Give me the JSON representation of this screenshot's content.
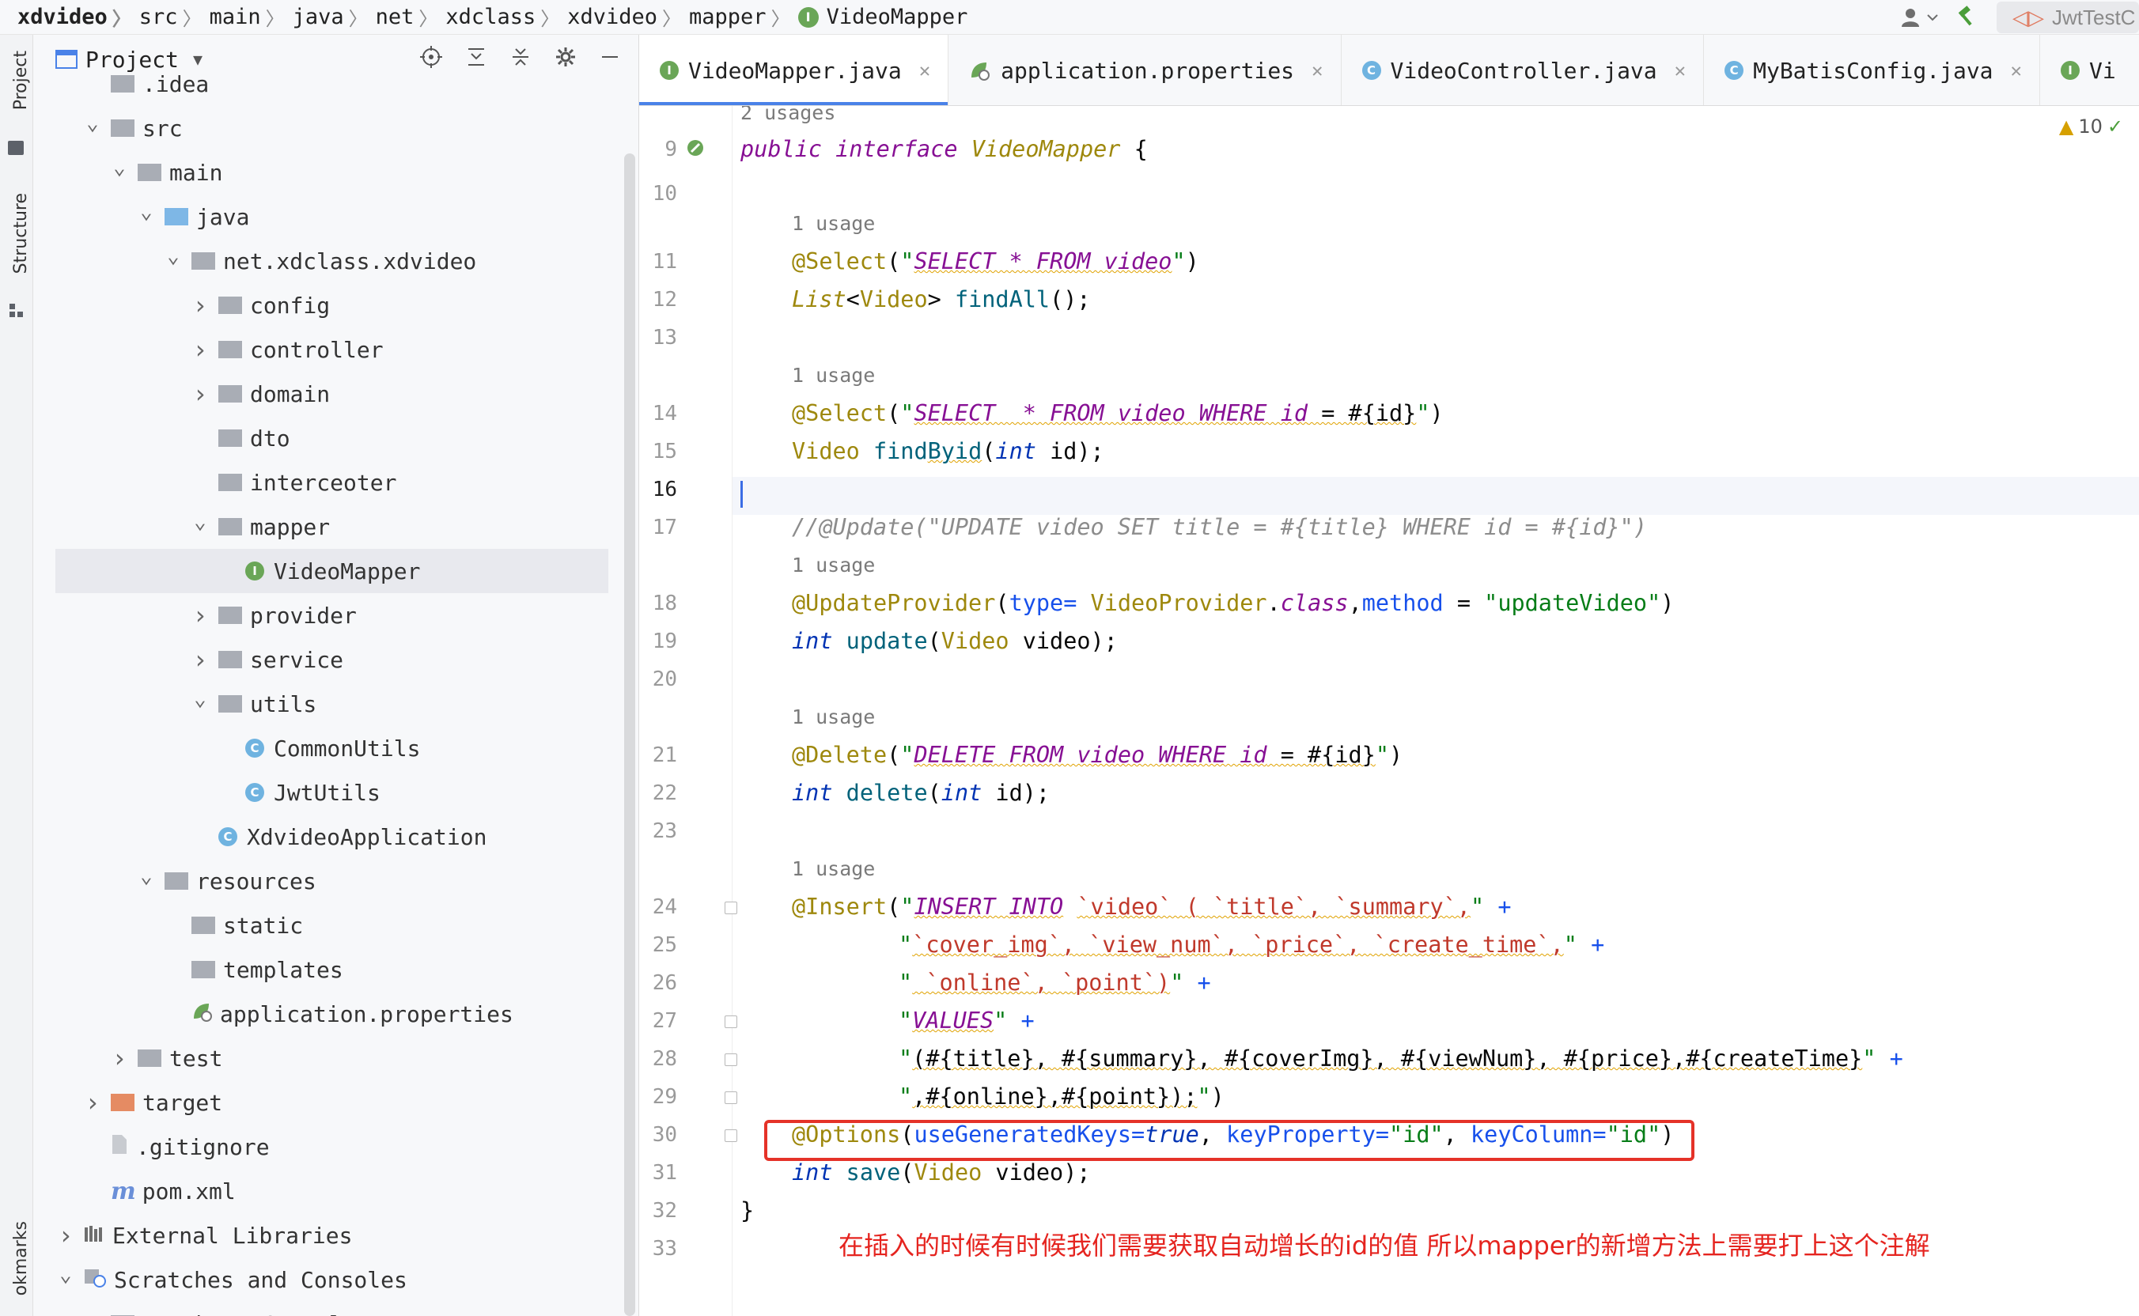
{
  "breadcrumb": [
    "xdvideo",
    "src",
    "main",
    "java",
    "net",
    "xdclass",
    "xdvideo",
    "mapper",
    "VideoMapper"
  ],
  "toolbar": {
    "run_config": "JwtTestC"
  },
  "side_tools": {
    "project": "Project",
    "structure": "Structure",
    "bookmarks": "okmarks"
  },
  "project_panel": {
    "title": "Project",
    "tree": [
      {
        "label": ".idea",
        "indent": 1,
        "kind": "folder-gray",
        "chev": ""
      },
      {
        "label": "src",
        "indent": 1,
        "kind": "folder-gray",
        "chev": "down"
      },
      {
        "label": "main",
        "indent": 2,
        "kind": "folder-gray",
        "chev": "down"
      },
      {
        "label": "java",
        "indent": 3,
        "kind": "folder-blue",
        "chev": "down"
      },
      {
        "label": "net.xdclass.xdvideo",
        "indent": 4,
        "kind": "folder-gray",
        "chev": "down"
      },
      {
        "label": "config",
        "indent": 5,
        "kind": "folder-gray",
        "chev": "right"
      },
      {
        "label": "controller",
        "indent": 5,
        "kind": "folder-gray",
        "chev": "right"
      },
      {
        "label": "domain",
        "indent": 5,
        "kind": "folder-gray",
        "chev": "right"
      },
      {
        "label": "dto",
        "indent": 5,
        "kind": "folder-gray",
        "chev": ""
      },
      {
        "label": "interceoter",
        "indent": 5,
        "kind": "folder-gray",
        "chev": ""
      },
      {
        "label": "mapper",
        "indent": 5,
        "kind": "folder-gray",
        "chev": "down"
      },
      {
        "label": "VideoMapper",
        "indent": 6,
        "kind": "interface",
        "chev": "",
        "selected": true
      },
      {
        "label": "provider",
        "indent": 5,
        "kind": "folder-gray",
        "chev": "right"
      },
      {
        "label": "service",
        "indent": 5,
        "kind": "folder-gray",
        "chev": "right"
      },
      {
        "label": "utils",
        "indent": 5,
        "kind": "folder-gray",
        "chev": "down"
      },
      {
        "label": "CommonUtils",
        "indent": 6,
        "kind": "class",
        "chev": ""
      },
      {
        "label": "JwtUtils",
        "indent": 6,
        "kind": "class",
        "chev": ""
      },
      {
        "label": "XdvideoApplication",
        "indent": 5,
        "kind": "class",
        "chev": ""
      },
      {
        "label": "resources",
        "indent": 3,
        "kind": "folder-gray",
        "chev": "down"
      },
      {
        "label": "static",
        "indent": 4,
        "kind": "folder-gray",
        "chev": ""
      },
      {
        "label": "templates",
        "indent": 4,
        "kind": "folder-gray",
        "chev": ""
      },
      {
        "label": "application.properties",
        "indent": 4,
        "kind": "props",
        "chev": ""
      },
      {
        "label": "test",
        "indent": 2,
        "kind": "folder-gray",
        "chev": "right"
      },
      {
        "label": "target",
        "indent": 1,
        "kind": "folder-orange",
        "chev": "right"
      },
      {
        "label": ".gitignore",
        "indent": 1,
        "kind": "file",
        "chev": ""
      },
      {
        "label": "pom.xml",
        "indent": 1,
        "kind": "maven",
        "chev": ""
      },
      {
        "label": "External Libraries",
        "indent": 0,
        "kind": "libs",
        "chev": "right"
      },
      {
        "label": "Scratches and Consoles",
        "indent": 0,
        "kind": "scratch",
        "chev": "down"
      },
      {
        "label": "Database Consoles",
        "indent": 1,
        "kind": "folder-gray",
        "chev": "right"
      }
    ]
  },
  "tabs": [
    {
      "label": "VideoMapper.java",
      "icon": "interface",
      "active": true
    },
    {
      "label": "application.properties",
      "icon": "props",
      "active": false
    },
    {
      "label": "VideoController.java",
      "icon": "class",
      "active": false
    },
    {
      "label": "MyBatisConfig.java",
      "icon": "class",
      "active": false
    },
    {
      "label": "Vi",
      "icon": "interface",
      "active": false
    }
  ],
  "editor": {
    "inspections": "10",
    "top_usage": "2 usages",
    "current_line": "16",
    "line_numbers": [
      "9",
      "10",
      "11",
      "12",
      "13",
      "14",
      "15",
      "16",
      "17",
      "18",
      "19",
      "20",
      "21",
      "22",
      "23",
      "24",
      "25",
      "26",
      "27",
      "28",
      "29",
      "30",
      "31",
      "32",
      "33"
    ],
    "usages": [
      "1 usage",
      "1 usage",
      "1 usage",
      "1 usage",
      "1 usage"
    ],
    "code": {
      "l9": "public interface VideoMapper {",
      "l11": "@Select(\"SELECT * FROM video\")",
      "l12": "List<Video> findAll();",
      "l14": "@Select(\"SELECT  * FROM video WHERE id = #{id}\")",
      "l15": "Video findByid(int id);",
      "l17": "//@Update(\"UPDATE video SET title = #{title} WHERE id = #{id}\")",
      "l18": "@UpdateProvider(type= VideoProvider.class,method = \"updateVideo\")",
      "l19": "int update(Video video);",
      "l21": "@Delete(\"DELETE FROM video WHERE id = #{id}\")",
      "l22": "int delete(int id);",
      "l24": "@Insert(\"INSERT INTO `video` ( `title`, `summary`,\" +",
      "l25": "\"`cover_img`, `view_num`, `price`, `create_time`,\" +",
      "l26": "\" `online`, `point`)\" +",
      "l27": "\"VALUES\" +",
      "l28": "\"(#{title}, #{summary}, #{coverImg}, #{viewNum}, #{price},#{createTime}\" +",
      "l29": "\",#{online},#{point});\")",
      "l30": "@Options(useGeneratedKeys=true, keyProperty=\"id\", keyColumn=\"id\")",
      "l31": "int save(Video video);",
      "l32": "}"
    },
    "note": "在插入的时候有时候我们需要获取自动增长的id的值 所以mapper的新增方法上需要打上这个注解"
  }
}
